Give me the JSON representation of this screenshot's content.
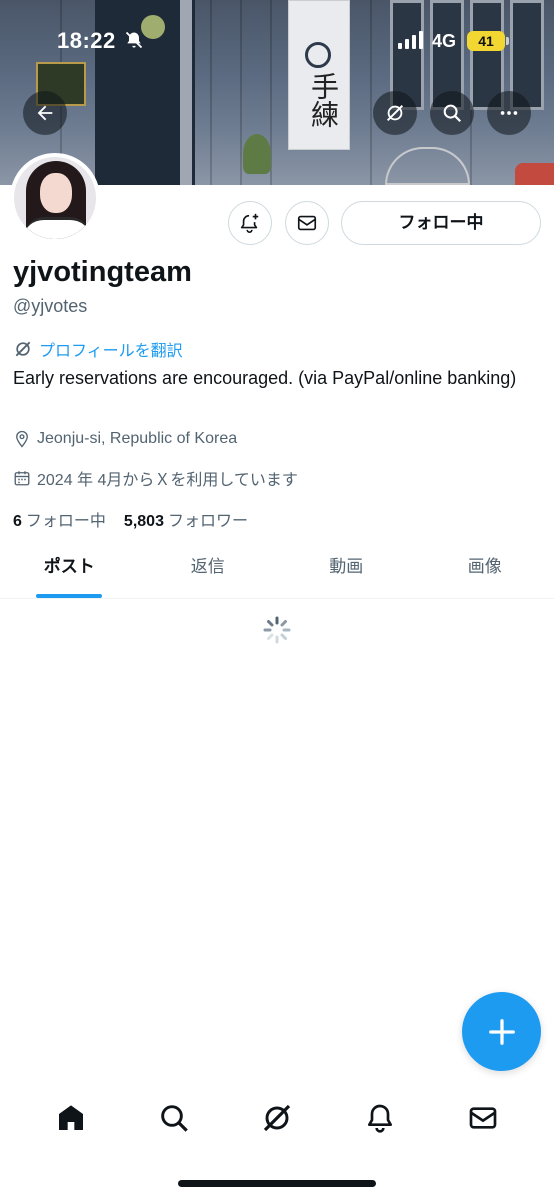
{
  "status_bar": {
    "time": "18:22",
    "network": "4G",
    "battery": "41"
  },
  "banner": {
    "sign_text": "手練",
    "icons": [
      "back-arrow-icon",
      "grok-icon",
      "search-icon",
      "more-icon"
    ]
  },
  "profile": {
    "display_name": "yjvotingteam",
    "handle": "@yjvotes",
    "translate_label": "プロフィールを翻訳",
    "bio": "Early reservations are encouraged. (via PayPal/online banking)",
    "location": "Jeonju-si, Republic of Korea",
    "joined": "2024 年 4月からＸを利用しています",
    "following_count": "6",
    "following_label": "フォロー中",
    "followers_count": "5,803",
    "followers_label": "フォロワー"
  },
  "actions": {
    "follow_label": "フォロー中"
  },
  "tabs": [
    {
      "label": "ポスト",
      "active": true
    },
    {
      "label": "返信",
      "active": false
    },
    {
      "label": "動画",
      "active": false
    },
    {
      "label": "画像",
      "active": false
    }
  ],
  "bottom_nav": [
    "home-icon",
    "search-icon",
    "grok-icon",
    "notifications-icon",
    "messages-icon"
  ],
  "colors": {
    "accent": "#1d9bf0",
    "text_primary": "#0f1419",
    "text_secondary": "#536471",
    "battery": "#f2d632"
  }
}
